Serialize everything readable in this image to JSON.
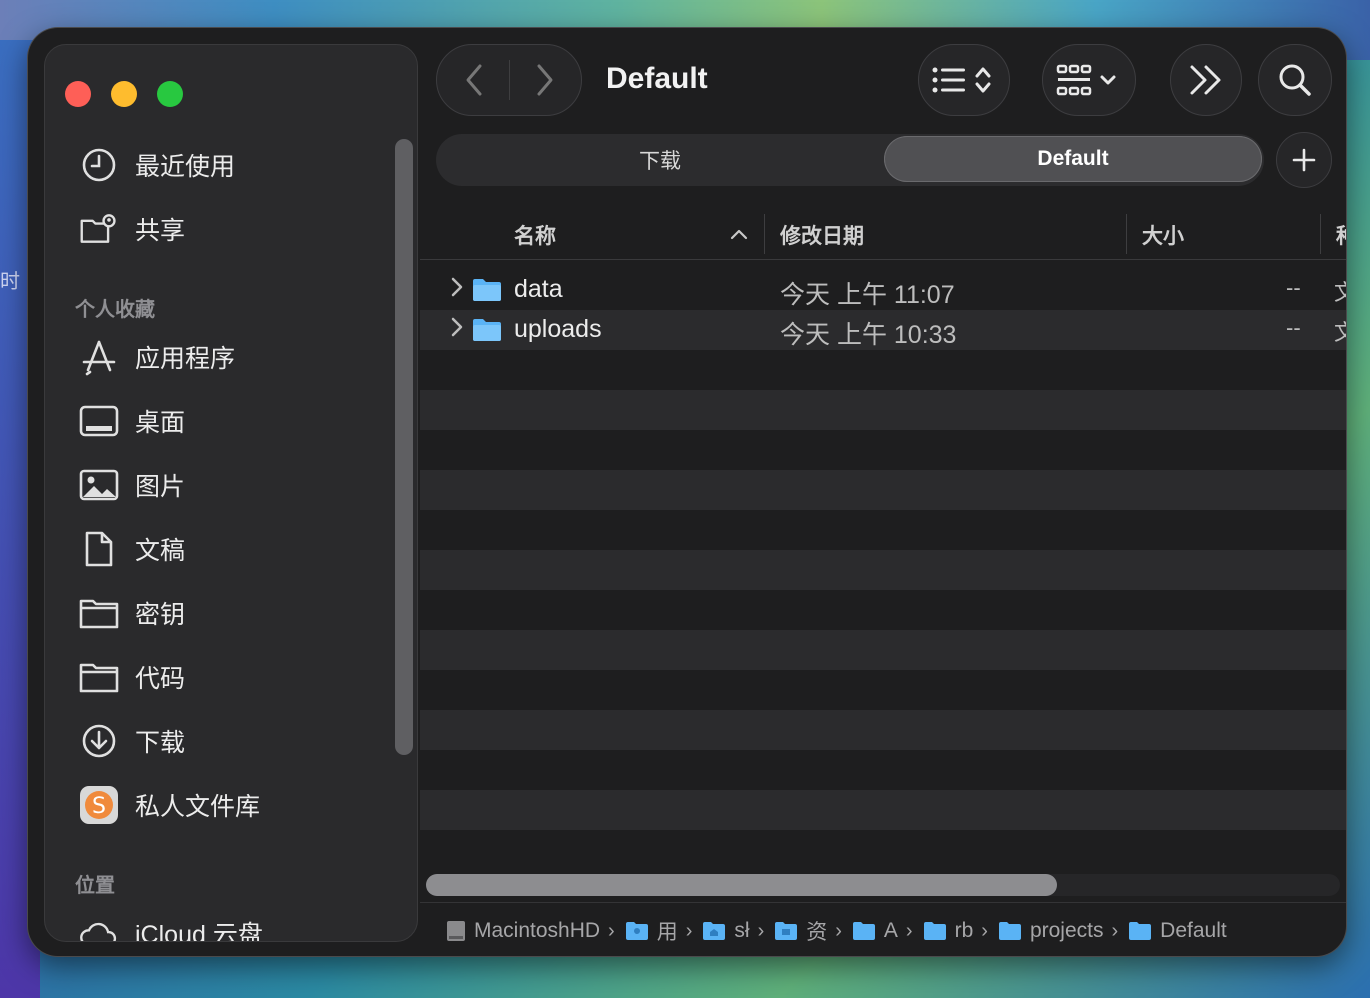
{
  "window": {
    "title": "Default"
  },
  "desktop": {
    "left_label": "时"
  },
  "tabs": [
    {
      "label": "下载",
      "active": false
    },
    {
      "label": "Default",
      "active": true
    }
  ],
  "sidebar": {
    "top_items": [
      {
        "label": "最近使用",
        "icon": "clock-icon"
      },
      {
        "label": "共享",
        "icon": "shared-folder-icon"
      }
    ],
    "favorites_heading": "个人收藏",
    "favorites": [
      {
        "label": "应用程序",
        "icon": "applications-icon"
      },
      {
        "label": "桌面",
        "icon": "desktop-icon"
      },
      {
        "label": "图片",
        "icon": "photo-icon"
      },
      {
        "label": "文稿",
        "icon": "document-icon"
      },
      {
        "label": "密钥",
        "icon": "folder-icon"
      },
      {
        "label": "代码",
        "icon": "folder-icon"
      },
      {
        "label": "下载",
        "icon": "download-icon"
      },
      {
        "label": "私人文件库",
        "icon": "app-s-icon"
      }
    ],
    "locations_heading": "位置",
    "locations": [
      {
        "label": "iCloud 云盘",
        "icon": "cloud-icon"
      }
    ]
  },
  "columns": {
    "name": "名称",
    "modified": "修改日期",
    "size": "大小",
    "kind": "种"
  },
  "files": [
    {
      "name": "data",
      "modified": "今天 上午 11:07",
      "size": "--",
      "kind": "文"
    },
    {
      "name": "uploads",
      "modified": "今天 上午 10:33",
      "size": "--",
      "kind": "文"
    }
  ],
  "horizontal_scroll_fraction": 0.69,
  "path": [
    "MacintoshHD",
    "用",
    "sł",
    "资",
    "A",
    "rb",
    "projects",
    "Default"
  ],
  "colors": {
    "accent_folder": "#5ab3f5",
    "close": "#fe5f57",
    "minimize": "#febc2e",
    "zoom": "#28c840"
  }
}
